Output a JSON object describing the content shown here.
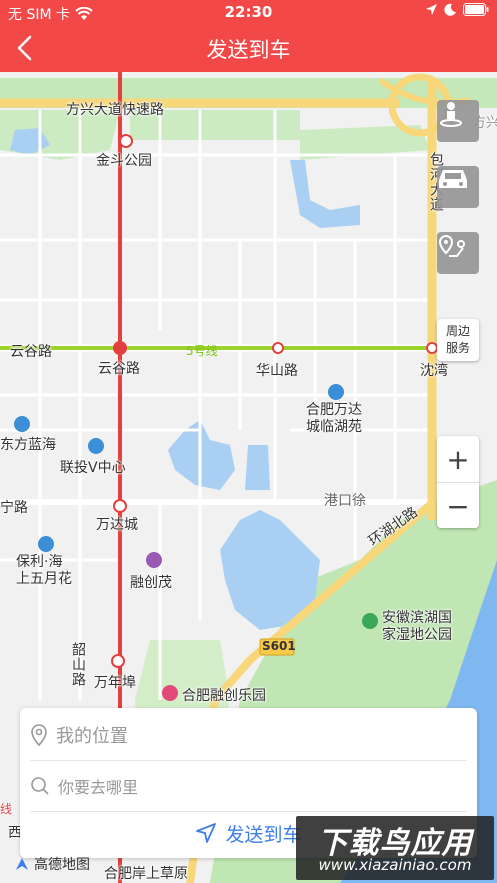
{
  "status_bar": {
    "carrier": "无 SIM 卡",
    "time": "22:30"
  },
  "nav": {
    "title": "发送到车"
  },
  "map": {
    "labels": {
      "fangxing_road": "方兴大道快速路",
      "fangxing_right": "方兴",
      "jindou_park": "金斗公园",
      "baohe_avenue": "包河大道",
      "yungu_road": "云谷路",
      "metro_line": "5号线",
      "yungu_station": "云谷路",
      "huashan_road": "华山路",
      "shenwan": "沈湾",
      "wanda_linhu": "合肥万达城临湖苑",
      "dongfang_lanhai": "东方蓝海",
      "lianto_center": "联投V中心",
      "gangkouxu": "港口徐",
      "ning_road": "宁路",
      "wanda_city": "万达城",
      "huanhu_north": "环湖北路",
      "poly_sea": "保利·海上五月花",
      "rongchuang_mao": "融创茂",
      "binhu_wetland": "安徽滨湖国家湿地公园",
      "s601": "S601",
      "shaoshan_road": "韶山路",
      "wannianbu": "万年埠",
      "rongchuang_park": "合肥融创乐园",
      "hefei_grassland": "合肥岸上草原",
      "line_left": "线",
      "xi_partial": "西"
    },
    "nearby": {
      "line1": "周边",
      "line2": "服务"
    },
    "zoom": {
      "plus": "+",
      "minus": "−"
    }
  },
  "panel": {
    "my_location": "我的位置",
    "where_to": "你要去哪里",
    "send_label": "发送到车"
  },
  "amap_logo": "高德地图",
  "watermark": {
    "title": "下载鸟应用",
    "url": "www.xiazainiao.com"
  },
  "colors": {
    "brand_red": "#f24848",
    "road_yellow": "#f7d77a",
    "metro_red": "#e34040",
    "line5_green": "#9bd22d",
    "water": "#7fb8f0",
    "park": "#bfe6b3",
    "link_blue": "#3b7fe8"
  }
}
